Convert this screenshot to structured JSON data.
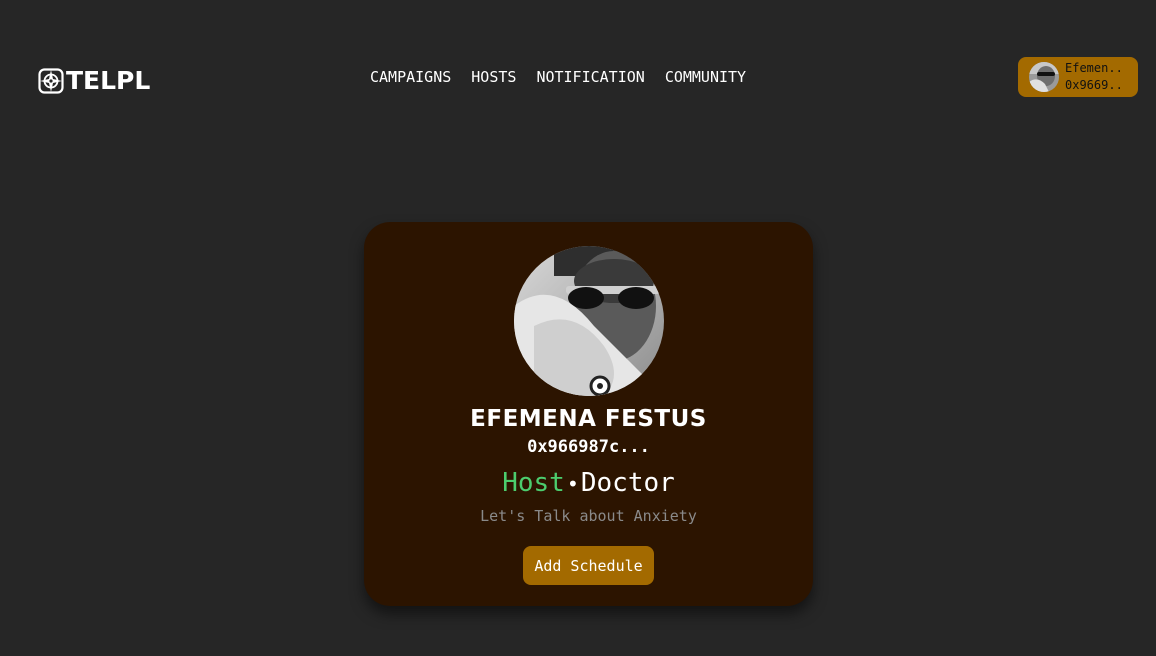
{
  "colors": {
    "background": "#262626",
    "card": "#2c1400",
    "accent": "#a36a00",
    "host_green": "#4ccd6e",
    "muted": "#8a8a8a"
  },
  "header": {
    "logo_text": "TELPL",
    "logo_icon": "compass-star-icon",
    "nav": [
      {
        "label": "CAMPAIGNS"
      },
      {
        "label": "HOSTS"
      },
      {
        "label": "NOTIFICATION"
      },
      {
        "label": "COMMUNITY"
      }
    ],
    "wallet": {
      "name": "Efemen..",
      "address": "0x9669.."
    }
  },
  "profile": {
    "name": "EFEMENA FESTUS",
    "address": "0x966987c...",
    "role": "Host",
    "separator": "•",
    "profession": "Doctor",
    "topic": "Let's Talk about Anxiety",
    "add_button": "Add Schedule"
  }
}
